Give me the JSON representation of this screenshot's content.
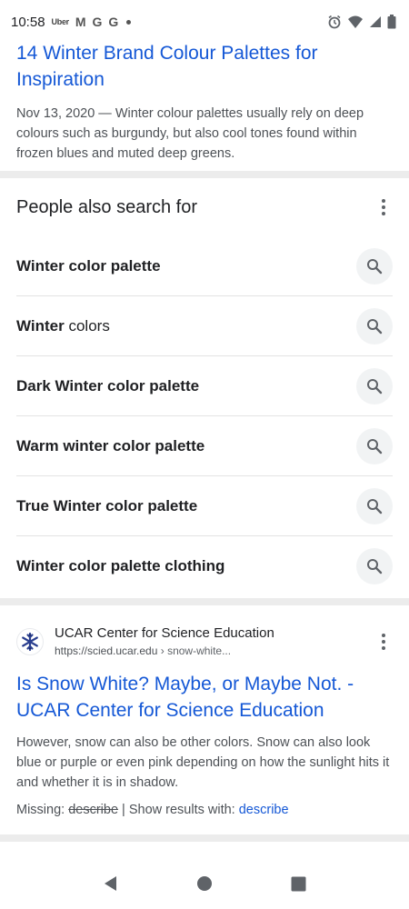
{
  "status_bar": {
    "time": "10:58",
    "uber_label": "Uber",
    "gmail_glyph": "M",
    "google_glyph_1": "G",
    "google_glyph_2": "G"
  },
  "result1": {
    "title": "14 Winter Brand Colour Palettes for Inspiration",
    "snippet": "Nov 13, 2020 — Winter colour palettes usually rely on deep colours such as burgundy, but also cool tones found within frozen blues and muted deep greens."
  },
  "people_also_search": {
    "heading": "People also search for",
    "items": [
      {
        "bold": "Winter color palette",
        "rest": ""
      },
      {
        "bold": "Winter",
        "rest": " colors"
      },
      {
        "bold": "Dark Winter color palette",
        "rest": ""
      },
      {
        "bold": "Warm winter color palette",
        "rest": ""
      },
      {
        "bold": "True Winter color palette",
        "rest": ""
      },
      {
        "bold": "Winter color palette clothing",
        "rest": ""
      }
    ]
  },
  "result2": {
    "site_name": "UCAR Center for Science Education",
    "url_host": "https://scied.ucar.edu",
    "url_path": " › snow-white...",
    "title": "Is Snow White? Maybe, or Maybe Not. - UCAR Center for Science Education",
    "snippet": "However, snow can also be other colors. Snow can also look blue or purple or even pink depending on how the sunlight hits it and whether it is in shadow.",
    "missing_label": "Missing: ",
    "missing_term": "describe",
    "show_results_label": " | Show results with: ",
    "show_results_term": "describe"
  },
  "icons": {
    "alarm": "alarm-icon",
    "wifi": "wifi-icon",
    "signal": "signal-icon",
    "battery": "battery-icon",
    "search": "search-icon",
    "more": "more-vert-icon",
    "favicon": "snowflake-icon",
    "nav_back": "back-icon",
    "nav_home": "home-icon",
    "nav_recents": "recents-icon"
  },
  "colors": {
    "link": "#1558d6",
    "text": "#202124",
    "snippet": "#4d5156",
    "divider": "#ececec",
    "search_chip": "#f1f3f4",
    "favicon": "#2a3f8f"
  }
}
